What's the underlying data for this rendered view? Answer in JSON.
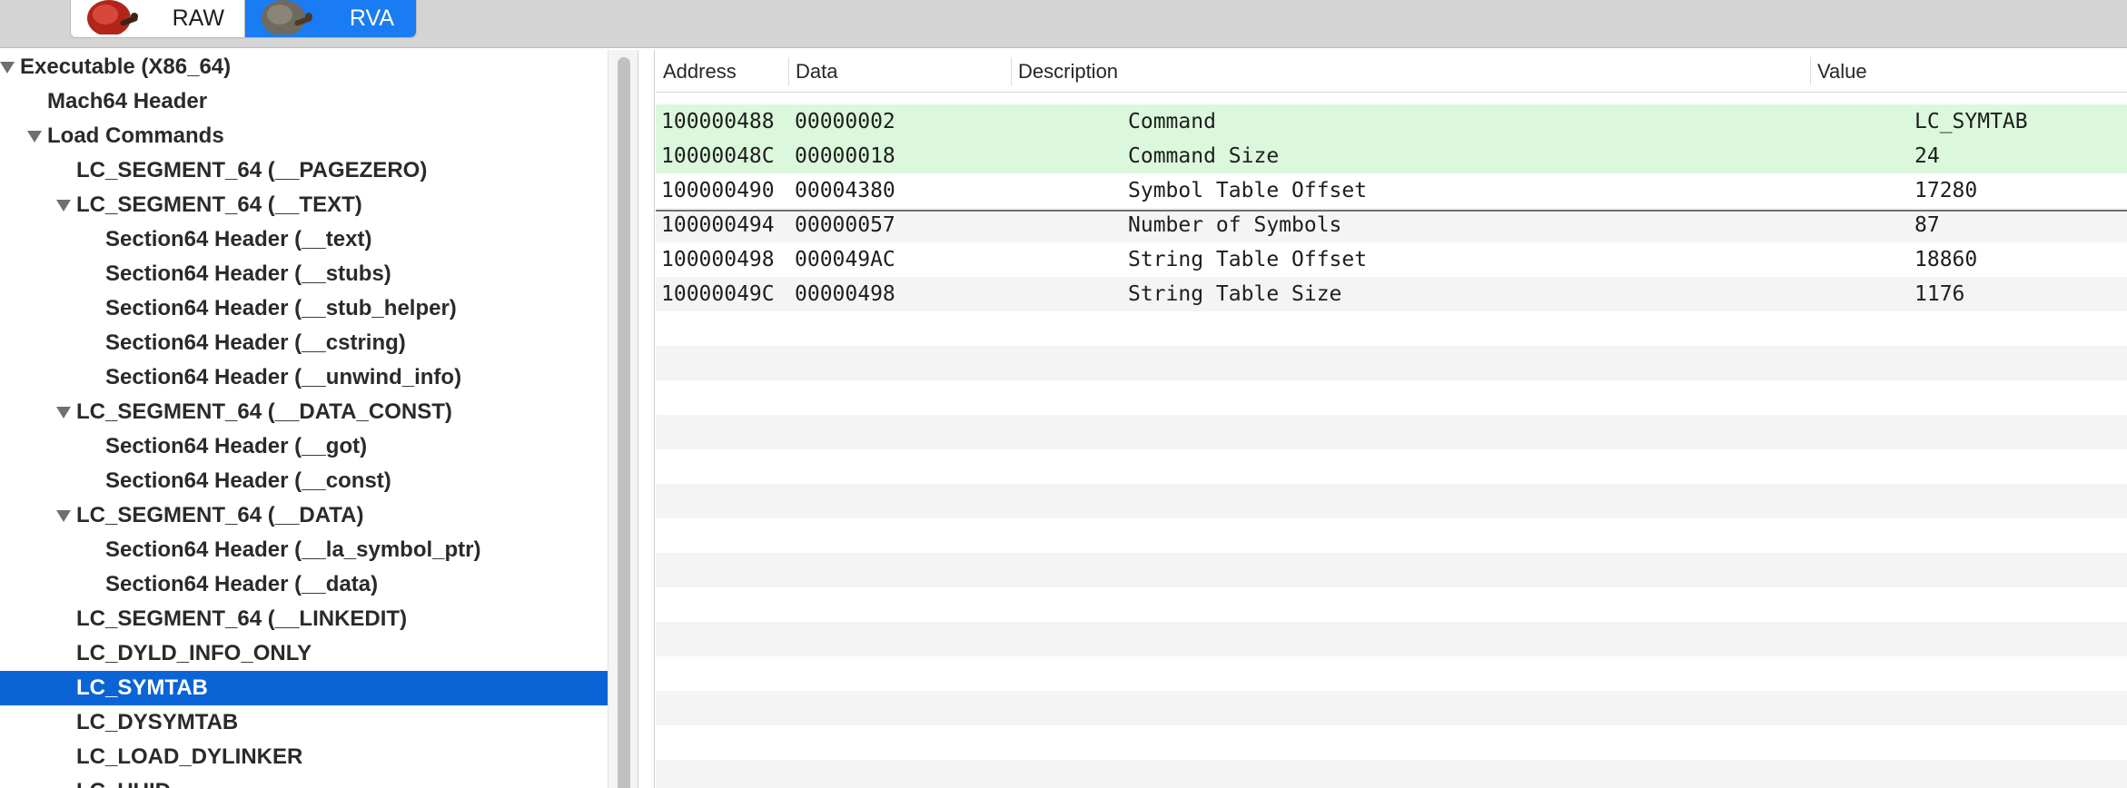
{
  "toolbar": {
    "segments": [
      {
        "label": "RAW",
        "selected": false
      },
      {
        "label": "RVA",
        "selected": true
      }
    ]
  },
  "tree": {
    "items": [
      {
        "label": "Executable  (X86_64)",
        "level": 0,
        "expanded": true
      },
      {
        "label": "Mach64 Header",
        "level": 1
      },
      {
        "label": "Load Commands",
        "level": 1,
        "expanded": true
      },
      {
        "label": "LC_SEGMENT_64 (__PAGEZERO)",
        "level": 2
      },
      {
        "label": "LC_SEGMENT_64 (__TEXT)",
        "level": 2,
        "expanded": true
      },
      {
        "label": "Section64 Header (__text)",
        "level": 3
      },
      {
        "label": "Section64 Header (__stubs)",
        "level": 3
      },
      {
        "label": "Section64 Header (__stub_helper)",
        "level": 3
      },
      {
        "label": "Section64 Header (__cstring)",
        "level": 3
      },
      {
        "label": "Section64 Header (__unwind_info)",
        "level": 3
      },
      {
        "label": "LC_SEGMENT_64 (__DATA_CONST)",
        "level": 2,
        "expanded": true
      },
      {
        "label": "Section64 Header (__got)",
        "level": 3
      },
      {
        "label": "Section64 Header (__const)",
        "level": 3
      },
      {
        "label": "LC_SEGMENT_64 (__DATA)",
        "level": 2,
        "expanded": true
      },
      {
        "label": "Section64 Header (__la_symbol_ptr)",
        "level": 3
      },
      {
        "label": "Section64 Header (__data)",
        "level": 3
      },
      {
        "label": "LC_SEGMENT_64 (__LINKEDIT)",
        "level": 2
      },
      {
        "label": "LC_DYLD_INFO_ONLY",
        "level": 2
      },
      {
        "label": "LC_SYMTAB",
        "level": 2,
        "selected": true
      },
      {
        "label": "LC_DYSYMTAB",
        "level": 2
      },
      {
        "label": "LC_LOAD_DYLINKER",
        "level": 2
      },
      {
        "label": "LC_UUID",
        "level": 2
      }
    ]
  },
  "table": {
    "columns": [
      "Address",
      "Data",
      "Description",
      "Value"
    ],
    "rows": [
      {
        "address": "100000488",
        "data": "00000002",
        "description": "Command",
        "value": "LC_SYMTAB",
        "highlighted": true
      },
      {
        "address": "10000048C",
        "data": "00000018",
        "description": "Command Size",
        "value": "24",
        "highlighted": true
      },
      {
        "address": "100000490",
        "data": "00004380",
        "description": "Symbol Table Offset",
        "value": "17280"
      },
      {
        "address": "100000494",
        "data": "00000057",
        "description": "Number of Symbols",
        "value": "87"
      },
      {
        "address": "100000498",
        "data": "000049AC",
        "description": "String Table Offset",
        "value": "18860"
      },
      {
        "address": "10000049C",
        "data": "00000498",
        "description": "String Table Size",
        "value": "1176"
      }
    ]
  },
  "colors": {
    "selection": "#0a64d6",
    "segment_selected": "#1a7cf3",
    "row_highlight": "#dcf8dc",
    "row_stripe": "#f3f4f3"
  }
}
